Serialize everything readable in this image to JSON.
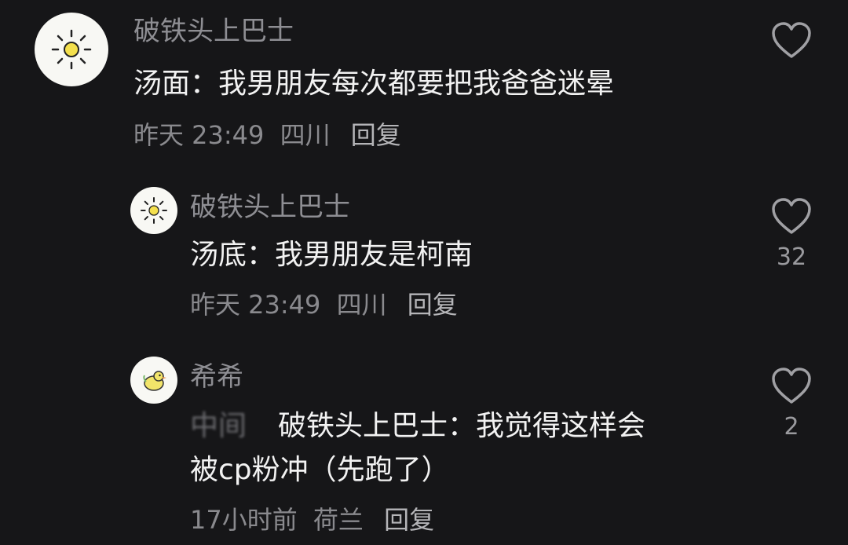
{
  "comments": [
    {
      "username": "破铁头上巴士",
      "text": "汤面：我男朋友每次都要把我爸爸迷晕",
      "time": "昨天 23:49",
      "location": "四川",
      "reply": "回复",
      "like_count": "",
      "avatar_icon": "sun-icon"
    },
    {
      "username": "破铁头上巴士",
      "text": "汤底：我男朋友是柯南",
      "time": "昨天 23:49",
      "location": "四川",
      "reply": "回复",
      "like_count": "32",
      "avatar_icon": "sun-icon"
    },
    {
      "username": "希希",
      "blurred_tag": "中间",
      "text_line1": "破铁头上巴士：我觉得这样会",
      "text_line2": "被cp粉冲（先跑了）",
      "time": "17小时前",
      "location": "荷兰",
      "reply": "回复",
      "like_count": "2",
      "avatar_icon": "duck-icon"
    }
  ],
  "colors": {
    "background": "#161618",
    "username": "#8e8e93",
    "text": "#f2f2f2",
    "meta": "#8a8a8e"
  }
}
